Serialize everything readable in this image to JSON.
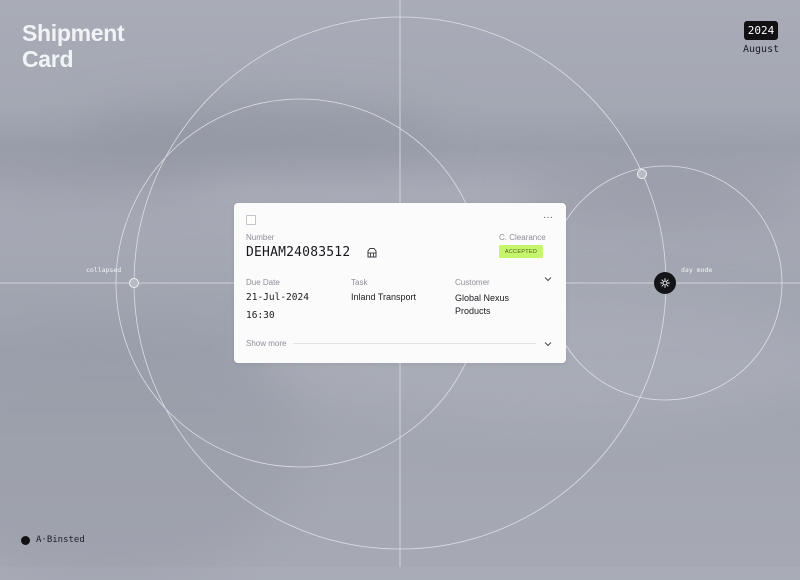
{
  "page": {
    "title_lines": [
      "Shipment",
      "Card"
    ],
    "year": "2024",
    "month": "August",
    "collapsed_label": "collapsed",
    "day_mode_label": "day mode",
    "author": "A·Binsted"
  },
  "card": {
    "number_label": "Number",
    "number": "DEHAM24083512",
    "clearance_label": "C. Clearance",
    "clearance_status": "ACCEPTED",
    "due_label": "Due Date",
    "due_date": "21-Jul-2024",
    "due_time": "16:30",
    "task_label": "Task",
    "task": "Inland Transport",
    "customer_label": "Customer",
    "customer": "Global Nexus Products",
    "show_more": "Show more",
    "more_glyph": "···"
  },
  "icons": {
    "container": "container-icon",
    "theme": "sun-icon",
    "more": "more-icon",
    "expand": "chevron-down-icon"
  },
  "colors": {
    "accent_status": "#c5f56a",
    "dark": "#131418"
  }
}
